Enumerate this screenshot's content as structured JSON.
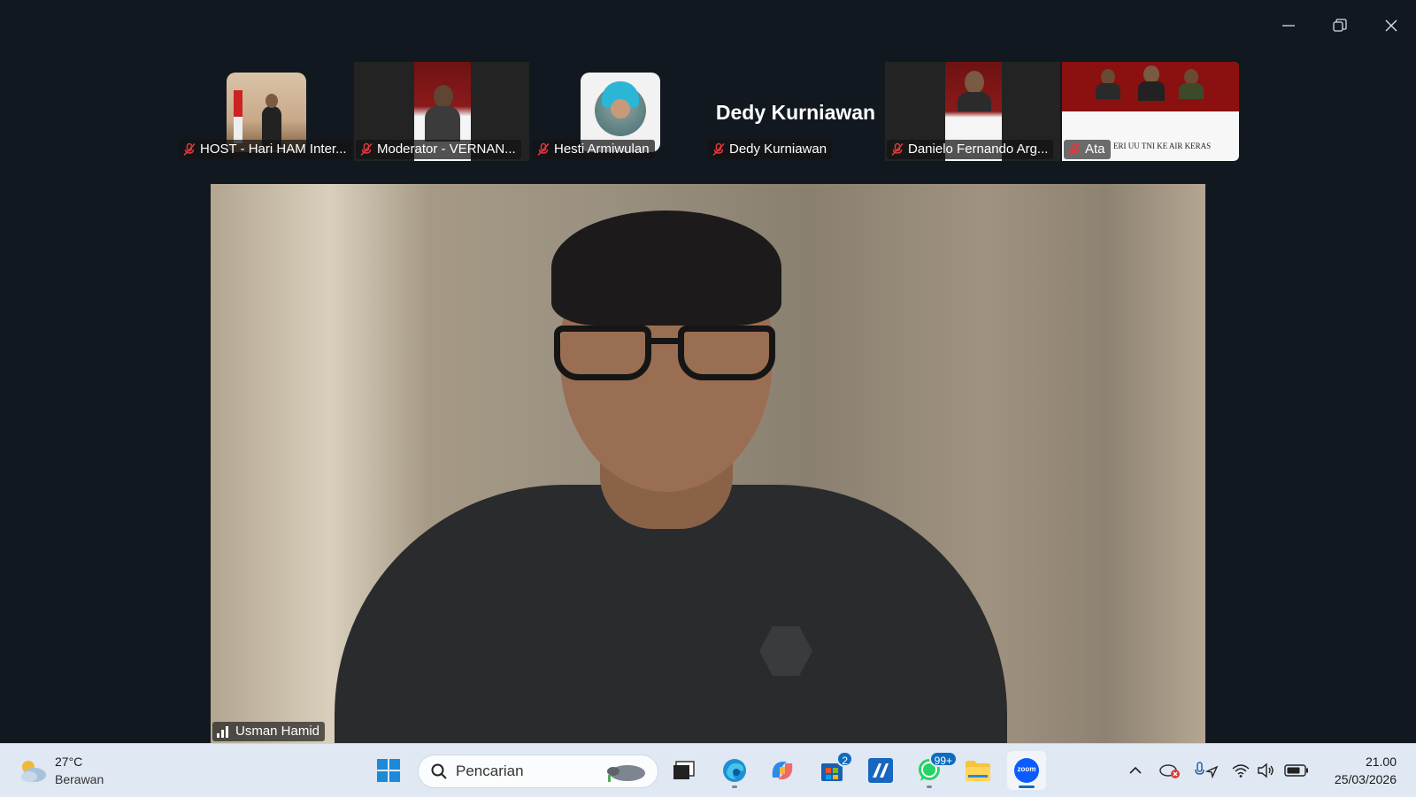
{
  "window": {
    "controls": [
      "minimize",
      "restore",
      "close"
    ]
  },
  "participants": [
    {
      "name": "HOST - Hari HAM Inter...",
      "muted": true,
      "has_video_thumb": true
    },
    {
      "name": "Moderator - VERNAN...",
      "muted": true,
      "has_video_thumb": true
    },
    {
      "name": "Hesti Armiwulan",
      "muted": true,
      "has_video_thumb": true
    },
    {
      "name": "Dedy Kurniawan",
      "display_name": "Dedy Kurniawan",
      "muted": true,
      "has_video_thumb": false
    },
    {
      "name": "Danielo Fernando Arg...",
      "muted": true,
      "has_video_thumb": true
    },
    {
      "name": "Ata",
      "muted": true,
      "has_video_thumb": true,
      "banner_text": "ERI UU TNI KE AIR KERAS"
    }
  ],
  "speaker": {
    "name": "Usman Hamid"
  },
  "taskbar": {
    "weather": {
      "temp": "27°C",
      "condition": "Berawan"
    },
    "search_placeholder": "Pencarian",
    "apps": [
      {
        "name": "start",
        "badge": ""
      },
      {
        "name": "task-view",
        "badge": ""
      },
      {
        "name": "edge",
        "badge": ""
      },
      {
        "name": "copilot",
        "badge": ""
      },
      {
        "name": "store",
        "badge": "2"
      },
      {
        "name": "app-m",
        "badge": ""
      },
      {
        "name": "whatsapp",
        "badge": "99+"
      },
      {
        "name": "file-explorer",
        "badge": ""
      },
      {
        "name": "zoom",
        "badge": "",
        "label": "zoom"
      }
    ],
    "clock": {
      "time": "21.00",
      "date": "25/03/2026"
    }
  },
  "colors": {
    "background": "#121820",
    "taskbar": "#dfe8f3",
    "accent": "#0f6cbd",
    "mute_red": "#e0393e",
    "banner_red": "#8b1010"
  }
}
